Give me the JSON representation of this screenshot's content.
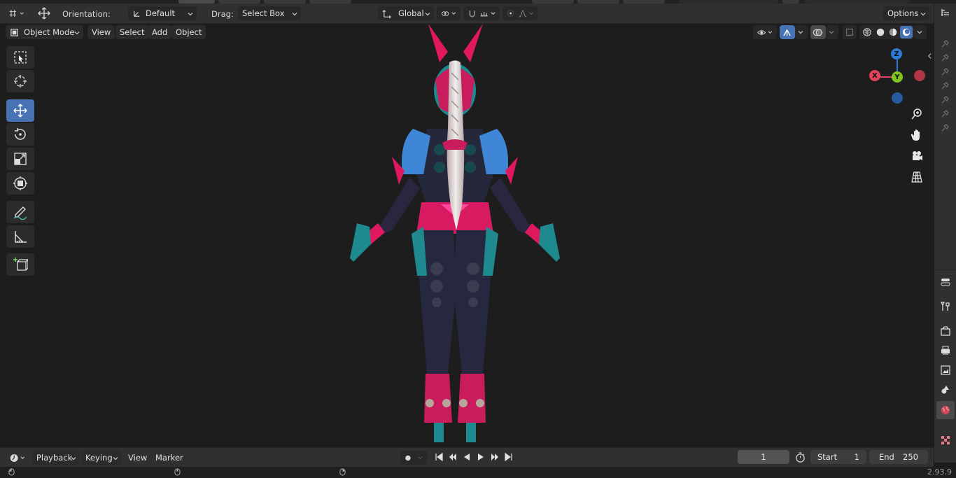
{
  "header": {
    "orientation_label": "Orientation:",
    "orientation_value": "Default",
    "drag_label": "Drag:",
    "drag_value": "Select Box",
    "transform_space": "Global",
    "options_label": "Options"
  },
  "viewport_header": {
    "mode": "Object Mode",
    "menus": [
      "View",
      "Select",
      "Add",
      "Object"
    ]
  },
  "toolbar": {
    "tools": [
      "select-box",
      "cursor",
      "move",
      "rotate",
      "scale",
      "transform",
      "annotate",
      "measure",
      "add-cube"
    ],
    "active": "move"
  },
  "gizmo": {
    "axes": {
      "x": "X",
      "y": "Y",
      "z": "Z"
    },
    "colors": {
      "x": "#e2425a",
      "y": "#7fc41f",
      "z": "#2f7ad8"
    }
  },
  "timeline": {
    "menus": [
      "Playback",
      "Keying",
      "View",
      "Marker"
    ],
    "current_frame": "1",
    "start_label": "Start",
    "start_value": "1",
    "end_label": "End",
    "end_value": "250"
  },
  "status": {
    "version": "2.93.9"
  },
  "colors": {
    "accent": "#4772b3",
    "header_bg": "#303030",
    "viewport_bg": "#1d1d1d"
  }
}
